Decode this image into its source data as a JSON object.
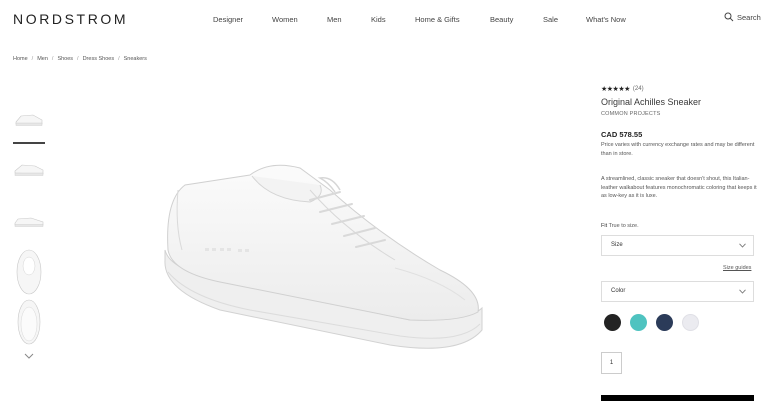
{
  "header": {
    "logo": "NORDSTROM",
    "nav": [
      "Designer",
      "Women",
      "Men",
      "Kids",
      "Home & Gifts",
      "Beauty",
      "Sale",
      "What's Now"
    ],
    "search_label": "Search"
  },
  "breadcrumb": [
    "Home",
    "Men",
    "Shoes",
    "Dress Shoes",
    "Sneakers"
  ],
  "product": {
    "stars": "★★★★★",
    "review_count": "(24)",
    "title": "Original Achilles Sneaker",
    "brand": "COMMON PROJECTS",
    "price": "CAD 578.55",
    "price_note": "Price varies with currency exchange rates and may be different than in store.",
    "description": "A streamlined, classic sneaker that doesn't shout, this Italian-leather walkabout features monochromatic coloring that keeps it as low-key as it is luxe.",
    "fit_label": "Fit",
    "fit_value": "True to size.",
    "size_select": "Size",
    "size_guide": "Size guides",
    "color_select": "Color",
    "swatch_colors": [
      "#232323",
      "#4fc3c0",
      "#2b3b59",
      "#ebebf0"
    ],
    "quantity": "1"
  },
  "colors": {
    "text": "#393939",
    "button": "#000000"
  }
}
